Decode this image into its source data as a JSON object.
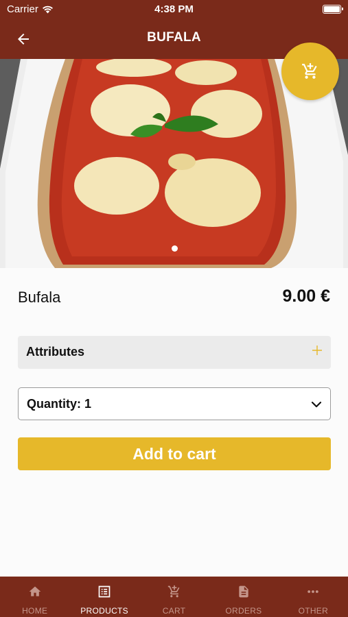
{
  "status_bar": {
    "carrier": "Carrier",
    "time": "4:38 PM"
  },
  "nav": {
    "title": "BUFALA",
    "back_icon": "arrow-left-icon"
  },
  "hero": {
    "image": "pizza-bufala-photo",
    "page_index": 1,
    "page_count": 1
  },
  "cart_fab": {
    "icon": "cart-icon"
  },
  "product": {
    "name": "Bufala",
    "price": "9.00 €"
  },
  "attributes": {
    "label": "Attributes",
    "icon": "plus-icon"
  },
  "quantity": {
    "label": "Quantity: 1",
    "icon": "chevron-down-icon"
  },
  "add_to_cart": {
    "label": "Add to cart"
  },
  "colors": {
    "brand": "#7a2a1a",
    "accent": "#e6b82a",
    "tab_inactive": "#c4958a"
  },
  "tabs": [
    {
      "label": "HOME",
      "icon": "home-icon",
      "active": false
    },
    {
      "label": "PRODUCTS",
      "icon": "list-icon",
      "active": true
    },
    {
      "label": "CART",
      "icon": "cart-icon",
      "active": false
    },
    {
      "label": "ORDERS",
      "icon": "document-icon",
      "active": false
    },
    {
      "label": "OTHER",
      "icon": "more-icon",
      "active": false
    }
  ]
}
